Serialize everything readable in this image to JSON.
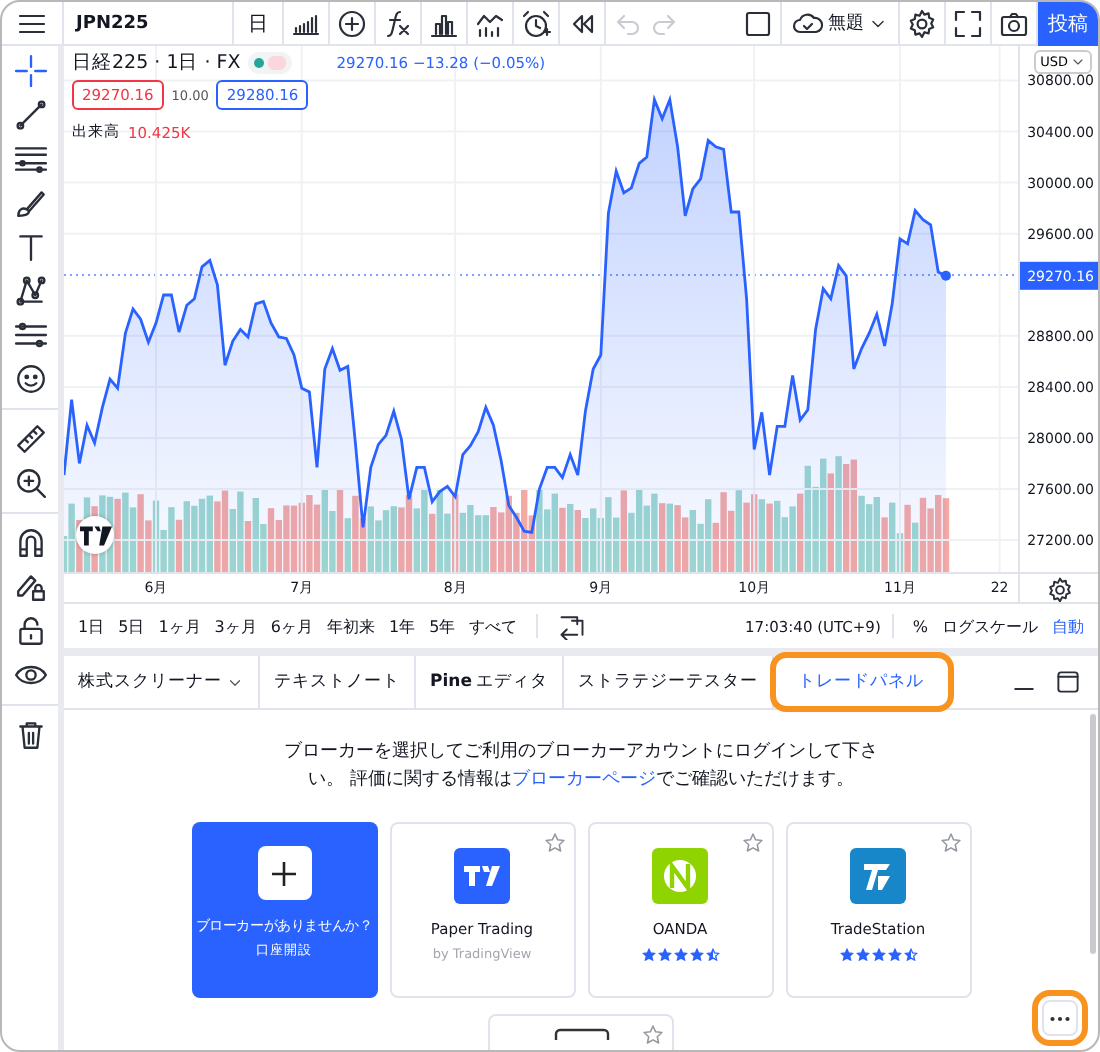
{
  "toolbar": {
    "symbol": "JPN225",
    "interval": "日",
    "layout_name": "無題",
    "publish_button": "投稿",
    "history": [
      {
        "kind": "undo",
        "disabled": true
      },
      {
        "kind": "redo",
        "disabled": true
      }
    ]
  },
  "drawing_tools": [
    {
      "kind": "crosshair",
      "selected": true
    },
    {
      "kind": "trend",
      "selected": false
    },
    {
      "kind": "lines",
      "selected": false
    },
    {
      "kind": "brush",
      "selected": false
    },
    {
      "kind": "text",
      "selected": false
    },
    {
      "kind": "pattern",
      "selected": false
    },
    {
      "kind": "forecast",
      "selected": false
    },
    {
      "kind": "emoji",
      "selected": false
    },
    {
      "kind": "ruler",
      "selected": false
    },
    {
      "kind": "zoom",
      "selected": false
    },
    {
      "kind": "magnet",
      "selected": false
    },
    {
      "kind": "lockpencil",
      "selected": false
    },
    {
      "kind": "lock",
      "selected": false
    },
    {
      "kind": "eye",
      "selected": false
    },
    {
      "kind": "trash",
      "selected": false
    }
  ],
  "legend": {
    "title": "日経225 · 1日 · FX",
    "quote": "29270.16 −13.28 (−0.05%)",
    "sell": "29270.16",
    "spread": "10.00",
    "buy": "29280.16",
    "volume_label": "出来高",
    "volume_value": "10.425K"
  },
  "price_axis": {
    "currency": "USD",
    "last_price": "29270.16"
  },
  "chart_data": {
    "type": "area",
    "ylim": [
      26950,
      31070
    ],
    "grid": true,
    "categories": [
      null,
      null,
      null,
      null,
      null,
      null,
      null,
      null,
      null,
      null,
      null,
      null,
      "6月",
      null,
      null,
      null,
      null,
      null,
      null,
      null,
      null,
      null,
      null,
      null,
      null,
      null,
      null,
      null,
      null,
      null,
      null,
      "7月",
      null,
      null,
      null,
      null,
      null,
      null,
      null,
      null,
      null,
      null,
      null,
      null,
      null,
      null,
      null,
      null,
      null,
      null,
      null,
      "8月",
      null,
      null,
      null,
      null,
      null,
      null,
      null,
      null,
      null,
      null,
      null,
      null,
      null,
      null,
      null,
      null,
      null,
      null,
      "9月",
      null,
      null,
      null,
      null,
      null,
      null,
      null,
      null,
      null,
      null,
      null,
      null,
      null,
      null,
      null,
      null,
      null,
      null,
      null,
      "10月",
      null,
      null,
      null,
      null,
      null,
      null,
      null,
      null,
      null,
      null,
      null,
      null,
      null,
      null,
      null,
      null,
      null,
      null,
      "11月",
      null,
      null,
      null,
      null,
      null,
      null,
      null,
      null,
      null,
      null,
      null,
      null,
      "22",
      null,
      null
    ],
    "series": [
      {
        "color": "#2962ff",
        "values": [
          27710,
          28300,
          27800,
          28100,
          27960,
          28240,
          28460,
          28390,
          28820,
          29010,
          28930,
          28750,
          28900,
          29120,
          29120,
          28830,
          29040,
          29090,
          29340,
          29390,
          29200,
          28570,
          28760,
          28850,
          28790,
          29050,
          29070,
          28900,
          28790,
          28780,
          28650,
          28390,
          28360,
          27770,
          28540,
          28700,
          28530,
          28560,
          27960,
          27300,
          27770,
          27950,
          28020,
          28210,
          27990,
          27520,
          27770,
          27770,
          27500,
          27580,
          27620,
          27540,
          27870,
          27940,
          28050,
          28240,
          28100,
          27820,
          27470,
          27380,
          27270,
          27260,
          27600,
          27770,
          27770,
          27690,
          27870,
          27710,
          28210,
          28540,
          28650,
          29760,
          30090,
          29920,
          29960,
          30150,
          30200,
          30650,
          30500,
          30650,
          30280,
          29740,
          29950,
          30030,
          30330,
          30280,
          30260,
          29770,
          29770,
          29090,
          27910,
          28200,
          27710,
          28090,
          28090,
          28490,
          28140,
          28220,
          28850,
          29170,
          29090,
          29350,
          29270,
          28540,
          28700,
          28820,
          28970,
          28720,
          29050,
          29560,
          29520,
          29780,
          29710,
          29670,
          29300,
          29270,
          null,
          null,
          null,
          null,
          null,
          null,
          null,
          null,
          null
        ]
      }
    ],
    "yticks": [
      {
        "value": 27200,
        "label": "27200.00"
      },
      {
        "value": 27600,
        "label": "27600.00"
      },
      {
        "value": 28000,
        "label": "28000.00"
      },
      {
        "value": 28400,
        "label": "28400.00"
      },
      {
        "value": 28800,
        "label": "28800.00"
      },
      {
        "value": 29600,
        "label": "29600.00"
      },
      {
        "value": 30000,
        "label": "30000.00"
      },
      {
        "value": 30400,
        "label": "30400.00"
      },
      {
        "value": 30800,
        "label": "30800.00"
      }
    ]
  },
  "range_bar": {
    "ranges": [
      "1日",
      "5日",
      "1ヶ月",
      "3ヶ月",
      "6ヶ月",
      "年初来",
      "1年",
      "5年",
      "すべて"
    ],
    "time": "17:03:40 (UTC+9)",
    "percent": "%",
    "log_scale": "ログスケール",
    "auto": "自動"
  },
  "bottom_panel": {
    "tabs": [
      {
        "label": "株式スクリーナー",
        "kind": "dropdown",
        "selected": false,
        "highlighted": false
      },
      {
        "label": "テキストノート",
        "kind": "tab",
        "selected": false,
        "highlighted": false
      },
      {
        "label": "Pine",
        "suffix": "エディタ",
        "kind": "bold_prefix",
        "selected": false,
        "highlighted": false
      },
      {
        "label": "ストラテジーテスター",
        "kind": "tab",
        "selected": false,
        "highlighted": false
      },
      {
        "label": "トレードパネル",
        "kind": "tab",
        "selected": true,
        "highlighted": true
      }
    ],
    "message": {
      "before": "ブローカーを選択してご利用のブローカーアカウントにログインして下さい。 評価に関する情報は",
      "link": "ブローカーページ",
      "after": "でご確認いただけます。"
    },
    "brokers": [
      {
        "kind": "open_account",
        "title": "ブローカーがありませんか？",
        "action": "口座開設"
      },
      {
        "kind": "broker",
        "name": "Paper Trading",
        "subtitle": "by TradingView",
        "favorite": false
      },
      {
        "kind": "broker",
        "name": "OANDA",
        "stars": 4.5,
        "favorite": false
      },
      {
        "kind": "broker",
        "name": "TradeStation",
        "stars": 4.5,
        "favorite": false
      },
      {
        "kind": "partial",
        "favorite": false
      }
    ],
    "more_button": {
      "highlighted": true
    }
  }
}
